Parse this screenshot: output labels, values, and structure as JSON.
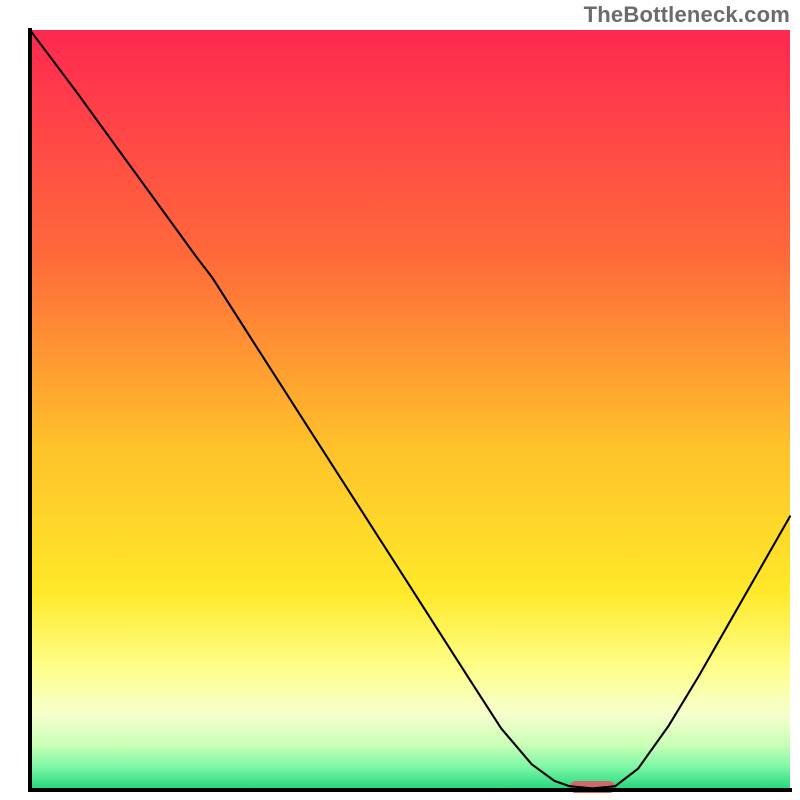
{
  "watermark": "TheBottleneck.com",
  "chart_data": {
    "type": "line",
    "title": "",
    "xlabel": "",
    "ylabel": "",
    "xlim": [
      0,
      100
    ],
    "ylim": [
      0,
      100
    ],
    "grid": false,
    "legend": false,
    "background_gradient_stops": [
      {
        "offset": 0.0,
        "color": "#ff2850"
      },
      {
        "offset": 0.3,
        "color": "#ff6a3a"
      },
      {
        "offset": 0.55,
        "color": "#ffc22a"
      },
      {
        "offset": 0.74,
        "color": "#ffe92a"
      },
      {
        "offset": 0.84,
        "color": "#feff8a"
      },
      {
        "offset": 0.9,
        "color": "#f6ffcd"
      },
      {
        "offset": 0.94,
        "color": "#caffb6"
      },
      {
        "offset": 0.97,
        "color": "#7cf7a5"
      },
      {
        "offset": 1.0,
        "color": "#1fd67a"
      }
    ],
    "series": [
      {
        "name": "bottleneck-curve",
        "color": "#000000",
        "width": 2.1,
        "points": [
          {
            "x": 0.0,
            "y": 100.0
          },
          {
            "x": 6.0,
            "y": 92.0
          },
          {
            "x": 14.0,
            "y": 81.0
          },
          {
            "x": 22.0,
            "y": 70.0
          },
          {
            "x": 24.0,
            "y": 67.4
          },
          {
            "x": 30.0,
            "y": 58.0
          },
          {
            "x": 40.0,
            "y": 42.4
          },
          {
            "x": 50.0,
            "y": 26.8
          },
          {
            "x": 58.0,
            "y": 14.3
          },
          {
            "x": 62.0,
            "y": 8.1
          },
          {
            "x": 66.0,
            "y": 3.4
          },
          {
            "x": 69.0,
            "y": 1.2
          },
          {
            "x": 71.0,
            "y": 0.5
          },
          {
            "x": 74.0,
            "y": 0.2
          },
          {
            "x": 77.0,
            "y": 0.5
          },
          {
            "x": 80.0,
            "y": 2.8
          },
          {
            "x": 84.0,
            "y": 8.4
          },
          {
            "x": 88.0,
            "y": 15.0
          },
          {
            "x": 92.0,
            "y": 22.0
          },
          {
            "x": 96.0,
            "y": 29.0
          },
          {
            "x": 100.0,
            "y": 36.0
          }
        ]
      }
    ],
    "bottleneck_marker": {
      "x_start": 71.0,
      "x_end": 77.0,
      "y": 0.4,
      "color": "#d06a6a",
      "thickness": 12
    },
    "axis": {
      "color": "#000000",
      "width": 4
    }
  }
}
